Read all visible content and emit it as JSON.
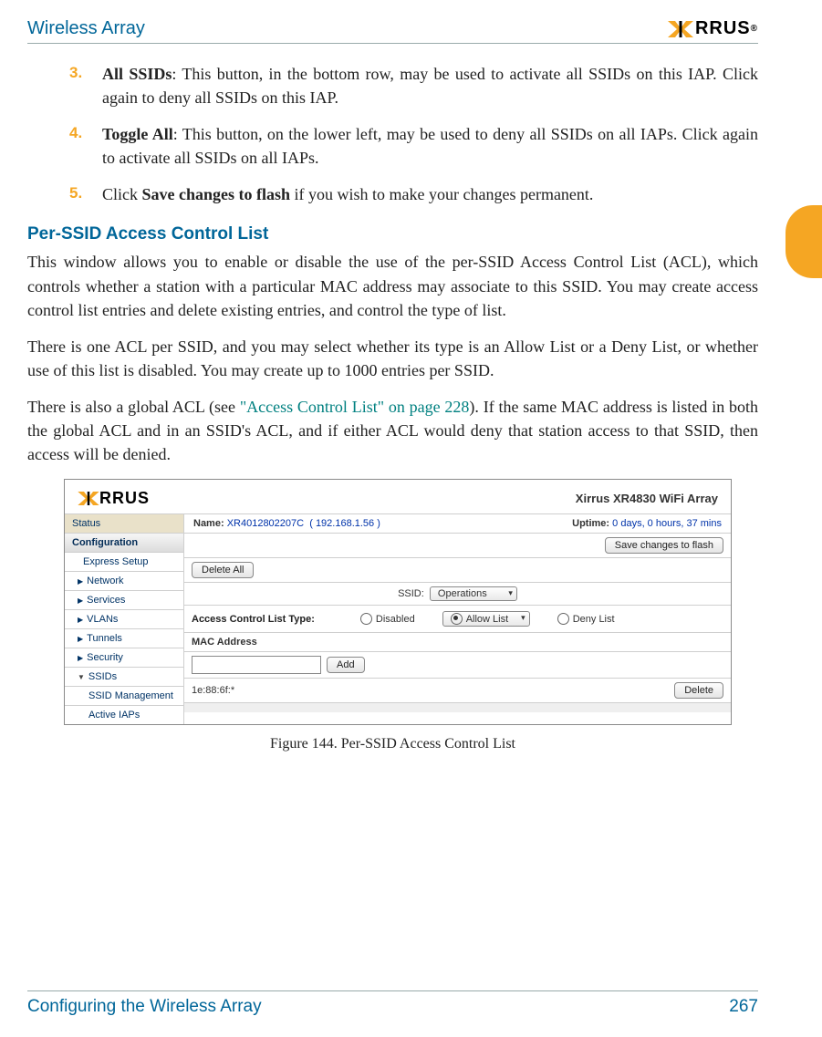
{
  "header": {
    "title": "Wireless Array",
    "logo_text": "RRUS",
    "logo_tm": "®"
  },
  "steps": [
    {
      "bold": "All SSIDs",
      "rest": ": This button, in the bottom row, may be used to activate all SSIDs on this IAP. Click again to deny all SSIDs on this IAP."
    },
    {
      "bold": "Toggle All",
      "rest": ": This button, on the lower left, may be used to deny all SSIDs on all IAPs. Click again to activate all SSIDs on all IAPs."
    },
    {
      "pre": "Click ",
      "bold": "Save changes to flash",
      "rest": " if you wish to make your changes permanent."
    }
  ],
  "section_title": "Per-SSID Access Control List",
  "para1": "This window allows you to enable or disable the use of the per-SSID Access Control List (ACL), which controls whether a station with a particular MAC address may associate to this SSID. You may create access control list entries and delete existing entries, and control the type of list.",
  "para2": "There is one ACL per SSID, and you may select whether its type is an Allow List or a Deny List, or whether use of this list is disabled. You may create up to 1000 entries per SSID.",
  "para3_a": "There is also a global ACL (see ",
  "para3_link": "\"Access Control List\" on page 228",
  "para3_b": "). If the same MAC address is listed in both the global ACL and in an SSID's ACL, and if either ACL would deny that station access to that SSID, then access will be denied.",
  "figure": {
    "logo_text": "RRUS",
    "product_prefix": "Xirrus ",
    "product_bold": "XR4830 WiFi Array",
    "name_label": "Name:",
    "name_value": "XR4012802207C",
    "name_ip": "( 192.168.1.56 )",
    "uptime_label": "Uptime:",
    "uptime_value": "0 days, 0 hours, 37 mins",
    "save_btn": "Save changes to flash",
    "delete_all": "Delete All",
    "ssid_label": "SSID:",
    "ssid_value": "Operations",
    "acl_type_label": "Access Control List Type:",
    "radio_disabled": "Disabled",
    "radio_allow": "Allow List",
    "radio_deny": "Deny List",
    "mac_header": "MAC Address",
    "add_btn": "Add",
    "list_entry": "1e:88:6f:*",
    "delete_btn": "Delete",
    "sidebar": {
      "status": "Status",
      "configuration": "Configuration",
      "express": "Express Setup",
      "network": "Network",
      "services": "Services",
      "vlans": "VLANs",
      "tunnels": "Tunnels",
      "security": "Security",
      "ssids": "SSIDs",
      "ssid_mgmt": "SSID Management",
      "active_iaps": "Active IAPs"
    }
  },
  "caption": "Figure 144. Per-SSID Access Control List",
  "footer": {
    "left": "Configuring the Wireless Array",
    "right": "267"
  }
}
